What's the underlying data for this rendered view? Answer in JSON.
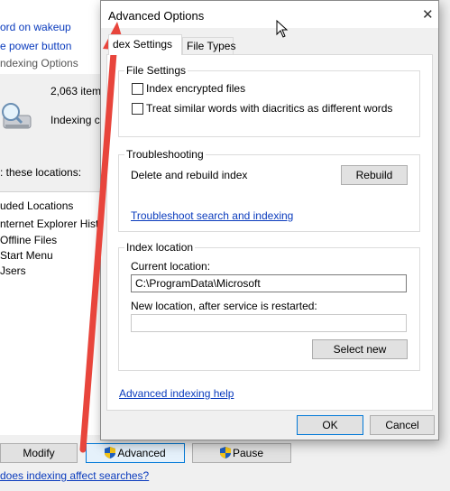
{
  "background_window": {
    "top_items": [
      "ord on wakeup",
      "e power button"
    ],
    "title": "ndexing Options",
    "indexed_count": "2,063 items",
    "status": "Indexing co",
    "locations_header": ": these locations:",
    "locations": [
      "uded Locations",
      "nternet Explorer Histo",
      "Offline Files",
      "Start Menu",
      "Jsers"
    ],
    "buttons": {
      "modify": "Modify",
      "advanced": "Advanced",
      "pause": "Pause"
    },
    "help_link": "does indexing affect searches?"
  },
  "dialog": {
    "title": "Advanced Options",
    "close_glyph": "✕",
    "tabs": [
      {
        "label": "dex Settings",
        "active": true
      },
      {
        "label": "File Types",
        "active": false
      }
    ],
    "file_settings": {
      "label": "File Settings",
      "options": [
        {
          "label": "Index encrypted files",
          "checked": false
        },
        {
          "label": "Treat similar words with diacritics as different words",
          "checked": false
        }
      ]
    },
    "troubleshooting": {
      "label": "Troubleshooting",
      "rebuild_text": "Delete and rebuild index",
      "rebuild_button": "Rebuild",
      "link": "Troubleshoot search and indexing"
    },
    "index_location": {
      "label": "Index location",
      "current_label": "Current location:",
      "current_value": "C:\\ProgramData\\Microsoft",
      "new_label": "New location, after service is restarted:",
      "new_value": "",
      "select_button": "Select new"
    },
    "help_link": "Advanced indexing help",
    "ok": "OK",
    "cancel": "Cancel"
  },
  "colors": {
    "arrow": "#e8453c",
    "link": "#0a3bbd",
    "accent_border": "#0078d7"
  }
}
